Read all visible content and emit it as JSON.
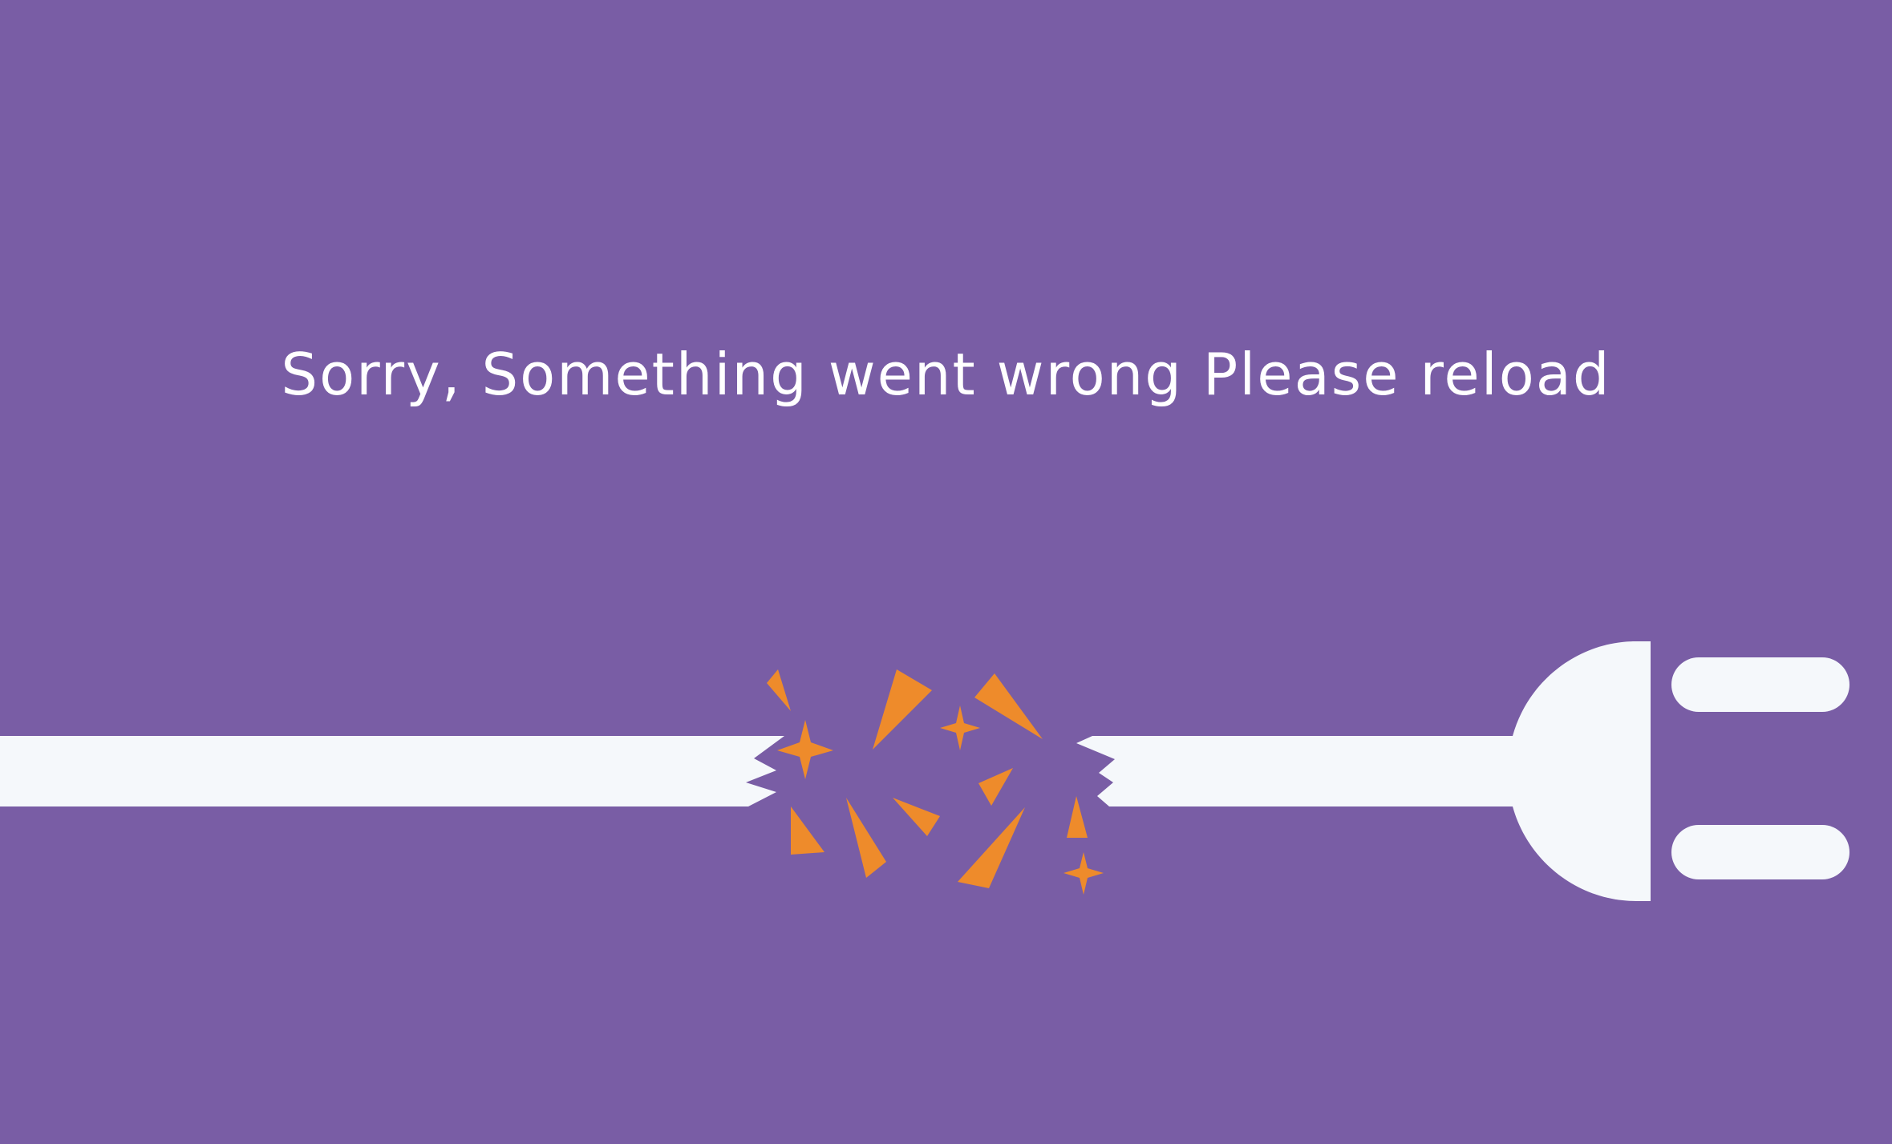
{
  "error": {
    "message": "Sorry, Something went wrong Please reload"
  },
  "illustration": {
    "subject": "unplugged-cable-icon",
    "background_color": "#795da5",
    "cable_color": "#f5f8fb",
    "spark_color": "#ee8b2b"
  }
}
